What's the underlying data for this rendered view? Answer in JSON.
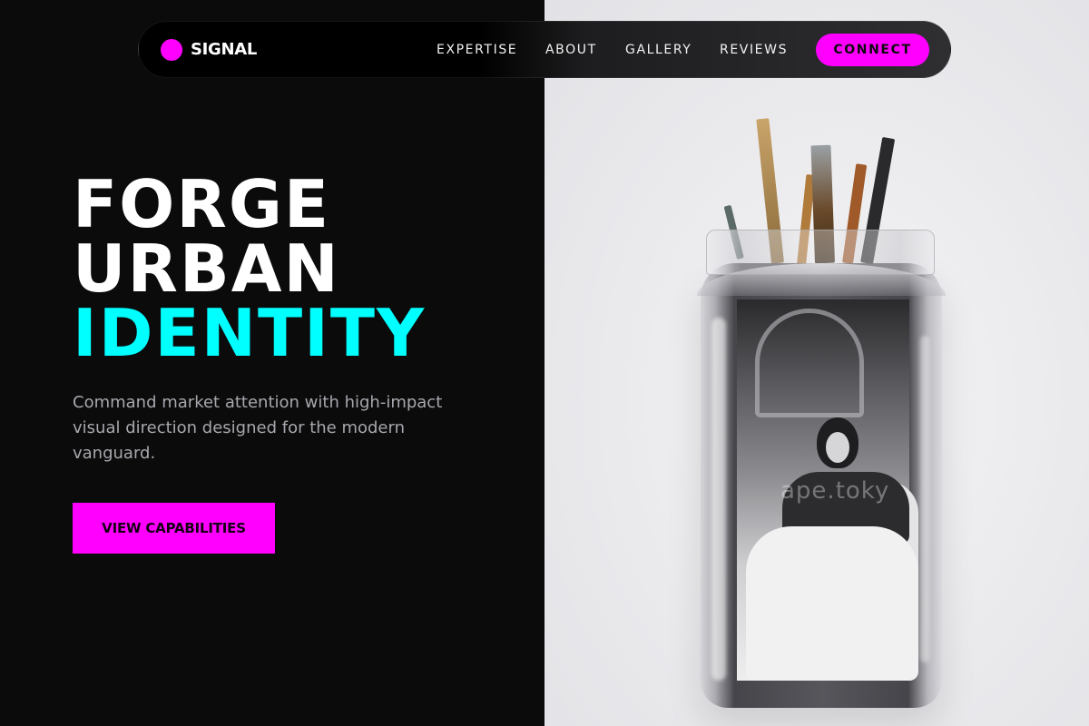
{
  "brand": {
    "name": "SIGNAL",
    "accent": "#ff00ff"
  },
  "nav": {
    "links": [
      "EXPERTISE",
      "ABOUT",
      "GALLERY",
      "REVIEWS"
    ],
    "cta_label": "CONNECT"
  },
  "hero": {
    "title_lines": [
      "FORGE",
      "URBAN",
      "IDENTITY"
    ],
    "accent_color": "#00ffff",
    "subtitle": "Command market attention with high-impact visual direction designed for the modern vanguard.",
    "cta_label": "VIEW CAPABILITIES"
  },
  "image": {
    "watermark": "ape.toky"
  },
  "colors": {
    "background": "#0b0b0c",
    "primary": "#ff00ff",
    "secondary": "#00ffff",
    "text": "#ffffff",
    "muted": "#a7a7ad"
  }
}
